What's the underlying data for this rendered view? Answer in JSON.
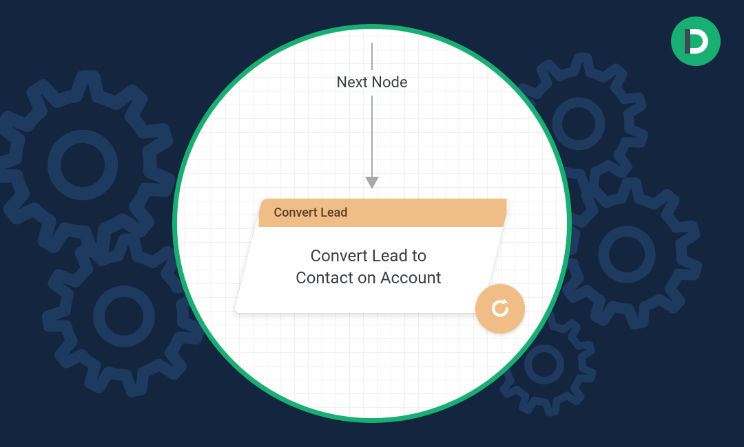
{
  "logo": {
    "letter": "D"
  },
  "flow": {
    "arrow_label": "Next Node",
    "node_header": "Convert Lead",
    "node_body_line1": "Convert Lead to",
    "node_body_line2": "Contact on Account"
  },
  "colors": {
    "bg": "#14263f",
    "accent": "#1aaf72",
    "node_header": "#f1bd86",
    "gear_stroke": "#1e3a5f"
  }
}
